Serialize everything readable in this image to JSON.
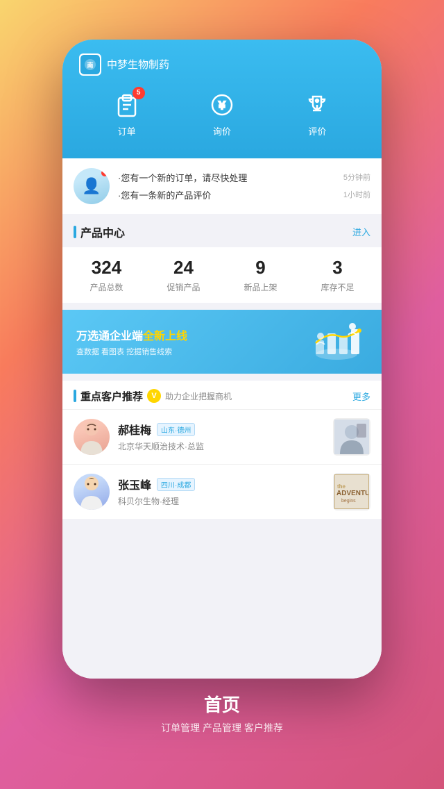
{
  "app": {
    "brand_name": "中梦生物制药",
    "bottom_title": "首页",
    "bottom_subtitle": "订单管理 产品管理 客户推荐"
  },
  "header": {
    "nav": [
      {
        "id": "orders",
        "label": "订单",
        "badge": "5",
        "icon": "clipboard-icon"
      },
      {
        "id": "inquiry",
        "label": "询价",
        "badge": null,
        "icon": "yen-icon"
      },
      {
        "id": "review",
        "label": "评价",
        "badge": null,
        "icon": "trophy-icon"
      }
    ]
  },
  "notifications": [
    {
      "text": "·您有一个新的订单，请尽快处理",
      "time": "5分钟前"
    },
    {
      "text": "·您有一条新的产品评价",
      "time": "1小时前"
    }
  ],
  "product_center": {
    "title": "产品中心",
    "link": "进入",
    "stats": [
      {
        "number": "324",
        "label": "产品总数"
      },
      {
        "number": "24",
        "label": "促销产品"
      },
      {
        "number": "9",
        "label": "新品上架"
      },
      {
        "number": "3",
        "label": "库存不足"
      }
    ]
  },
  "banner": {
    "title_prefix": "万选通企业端",
    "title_highlight": "全新上线",
    "subtitle": "查数据 看图表 挖掘销售线索"
  },
  "customers": {
    "title": "重点客户推荐",
    "subtitle": "助力企业把握商机",
    "more": "更多",
    "list": [
      {
        "name": "郝桂梅",
        "region": "山东·德州",
        "desc": "北京华天顺治技术·总监",
        "avatar_type": "female"
      },
      {
        "name": "张玉峰",
        "region": "四川·成都",
        "desc": "科贝尔生物·经理",
        "avatar_type": "male"
      }
    ]
  }
}
